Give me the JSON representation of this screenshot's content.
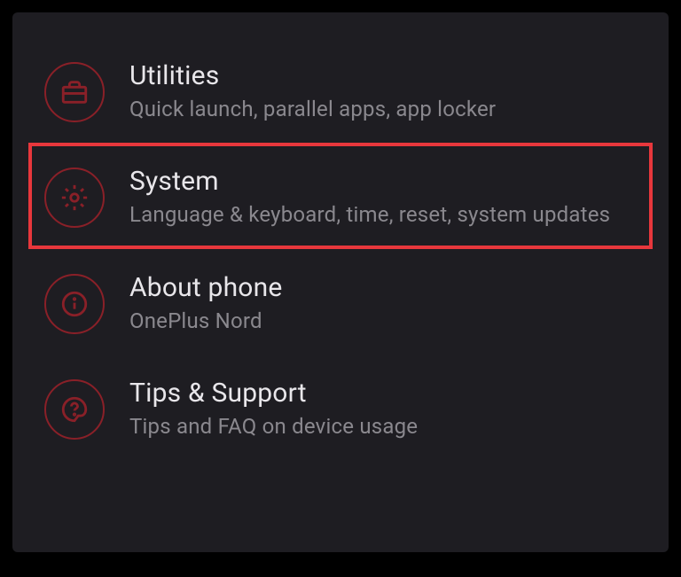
{
  "settings": {
    "items": [
      {
        "title": "Utilities",
        "subtitle": "Quick launch, parallel apps, app locker"
      },
      {
        "title": "System",
        "subtitle": "Language & keyboard, time, reset, system updates"
      },
      {
        "title": "About phone",
        "subtitle": "OnePlus Nord"
      },
      {
        "title": "Tips & Support",
        "subtitle": "Tips and FAQ on device usage"
      }
    ]
  },
  "colors": {
    "background": "#1e1d22",
    "icon_border": "#8a2028",
    "highlight": "#e8373c",
    "title": "#e8e6ea",
    "subtitle": "#8a888e"
  }
}
